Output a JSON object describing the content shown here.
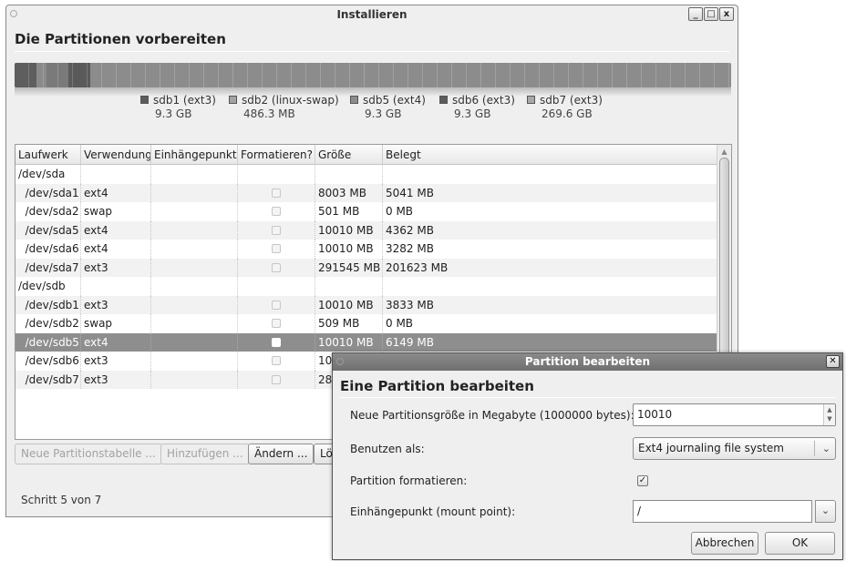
{
  "window": {
    "title": "Installieren",
    "heading": "Die Partitionen vorbereiten",
    "controls": {
      "minimize": "_",
      "maximize": "□",
      "close": "x"
    }
  },
  "partition_bar": {
    "segments": [
      {
        "name": "sdb1",
        "fraction": 0.03,
        "color": "#5e5e5e"
      },
      {
        "name": "sdb2",
        "fraction": 0.015,
        "color": "#8a8a8a"
      },
      {
        "name": "sdb5",
        "fraction": 0.03,
        "color": "#7a7a7a"
      },
      {
        "name": "sdb6",
        "fraction": 0.03,
        "color": "#5a5a5a"
      },
      {
        "name": "sdb7",
        "fraction": 0.895,
        "color": "#8c8c8c"
      }
    ]
  },
  "legend": [
    {
      "label": "sdb1 (ext3)",
      "size": "9.3 GB",
      "color": "#5c5c5c"
    },
    {
      "label": "sdb2 (linux-swap)",
      "size": "486.3 MB",
      "color": "#a4a4a4"
    },
    {
      "label": "sdb5 (ext4)",
      "size": "9.3 GB",
      "color": "#8c8c8c"
    },
    {
      "label": "sdb6 (ext3)",
      "size": "9.3 GB",
      "color": "#5c5c5c"
    },
    {
      "label": "sdb7 (ext3)",
      "size": "269.6 GB",
      "color": "#a8a8a8"
    }
  ],
  "table": {
    "headers": [
      "Laufwerk",
      "Verwendung",
      "Einhängepunkt",
      "Formatieren?",
      "Größe",
      "Belegt"
    ],
    "rows": [
      {
        "device": "/dev/sda",
        "use": "",
        "mount": "",
        "format": null,
        "size": "",
        "used": ""
      },
      {
        "device": "  /dev/sda1",
        "use": "ext4",
        "mount": "",
        "format": false,
        "size": "8003 MB",
        "used": "5041 MB"
      },
      {
        "device": "  /dev/sda2",
        "use": "swap",
        "mount": "",
        "format": false,
        "size": "501 MB",
        "used": "0 MB"
      },
      {
        "device": "  /dev/sda5",
        "use": "ext4",
        "mount": "",
        "format": false,
        "size": "10010 MB",
        "used": "4362 MB"
      },
      {
        "device": "  /dev/sda6",
        "use": "ext4",
        "mount": "",
        "format": false,
        "size": "10010 MB",
        "used": "3282 MB"
      },
      {
        "device": "  /dev/sda7",
        "use": "ext3",
        "mount": "",
        "format": false,
        "size": "291545 MB",
        "used": "201623 MB"
      },
      {
        "device": "/dev/sdb",
        "use": "",
        "mount": "",
        "format": null,
        "size": "",
        "used": ""
      },
      {
        "device": "  /dev/sdb1",
        "use": "ext3",
        "mount": "",
        "format": false,
        "size": "10010 MB",
        "used": "3833 MB"
      },
      {
        "device": "  /dev/sdb2",
        "use": "swap",
        "mount": "",
        "format": false,
        "size": "509 MB",
        "used": "0 MB"
      },
      {
        "device": "  /dev/sdb5",
        "use": "ext4",
        "mount": "",
        "format": false,
        "size": "10010 MB",
        "used": "6149 MB",
        "selected": true
      },
      {
        "device": "  /dev/sdb6",
        "use": "ext3",
        "mount": "",
        "format": false,
        "size": "100",
        "used": ""
      },
      {
        "device": "  /dev/sdb7",
        "use": "ext3",
        "mount": "",
        "format": false,
        "size": "28",
        "used": ""
      }
    ]
  },
  "buttons": {
    "new_table": "Neue Partitionstabelle ...",
    "add": "Hinzufügen ...",
    "change": "Ändern ...",
    "delete": "Lö"
  },
  "step": "Schritt 5 von 7",
  "dialog": {
    "title": "Partition bearbeiten",
    "heading": "Eine Partition bearbeiten",
    "size_label": "Neue Partitionsgröße in Megabyte (1000000 bytes):",
    "size_value": "10010",
    "use_label": "Benutzen als:",
    "use_value": "Ext4 journaling file system",
    "format_label": "Partition formatieren:",
    "format_checked": true,
    "mount_label": "Einhängepunkt (mount point):",
    "mount_value": "/",
    "cancel": "Abbrechen",
    "ok": "OK"
  }
}
